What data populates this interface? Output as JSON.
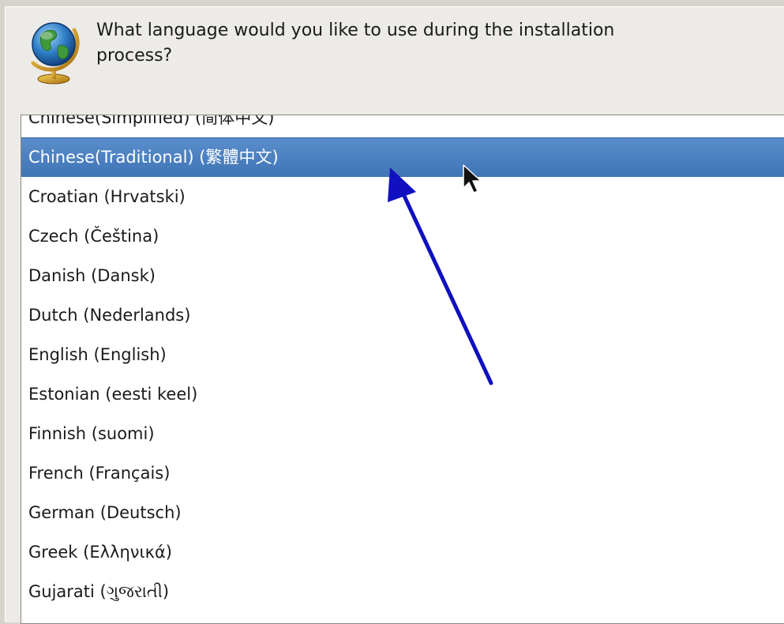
{
  "dialog": {
    "question": "What language would you like to use during the installation process?"
  },
  "languages": [
    {
      "label": "Chinese(Simplified) (简体中文)",
      "selected": false
    },
    {
      "label": "Chinese(Traditional) (繁體中文)",
      "selected": true
    },
    {
      "label": "Croatian (Hrvatski)",
      "selected": false
    },
    {
      "label": "Czech (Čeština)",
      "selected": false
    },
    {
      "label": "Danish (Dansk)",
      "selected": false
    },
    {
      "label": "Dutch (Nederlands)",
      "selected": false
    },
    {
      "label": "English (English)",
      "selected": false
    },
    {
      "label": "Estonian (eesti keel)",
      "selected": false
    },
    {
      "label": "Finnish (suomi)",
      "selected": false
    },
    {
      "label": "French (Français)",
      "selected": false
    },
    {
      "label": "German (Deutsch)",
      "selected": false
    },
    {
      "label": "Greek (Ελληνικά)",
      "selected": false
    },
    {
      "label": "Gujarati (ગુજરાતી)",
      "selected": false
    }
  ],
  "colors": {
    "selection": "#4a7fbf",
    "annotation_arrow": "#1010c0"
  },
  "icons": {
    "header": "globe-icon",
    "cursor": "mouse-pointer-icon",
    "annotation": "arrow-annotation-icon"
  }
}
